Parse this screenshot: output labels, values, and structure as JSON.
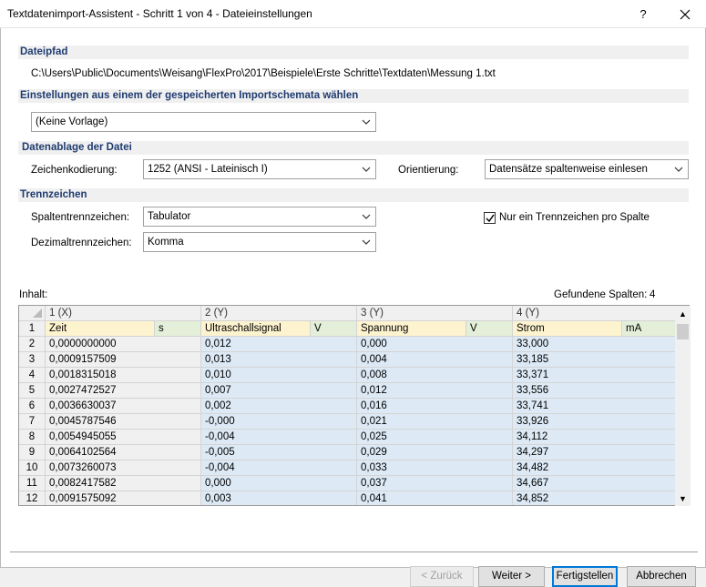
{
  "window": {
    "title": "Textdatenimport-Assistent - Schritt 1 von 4 - Dateieinstellungen",
    "help": "?",
    "close": "✕"
  },
  "sections": {
    "path": {
      "header": "Dateipfad",
      "value": "C:\\Users\\Public\\Documents\\Weisang\\FlexPro\\2017\\Beispiele\\Erste Schritte\\Textdaten\\Messung 1.txt"
    },
    "schema": {
      "header": "Einstellungen aus einem der gespeicherten Importschemata wählen",
      "combo": "(Keine Vorlage)"
    },
    "storage": {
      "header": "Datenablage der Datei",
      "encoding_label": "Zeichenkodierung:",
      "encoding_value": "1252  (ANSI - Lateinisch I)",
      "orientation_label": "Orientierung:",
      "orientation_value": "Datensätze spaltenweise einlesen"
    },
    "separators": {
      "header": "Trennzeichen",
      "column_label": "Spaltentrennzeichen:",
      "column_value": "Tabulator",
      "decimal_label": "Dezimaltrennzeichen:",
      "decimal_value": "Komma",
      "single_sep_label": "Nur ein Trennzeichen pro Spalte",
      "single_sep_checked": true
    }
  },
  "content": {
    "label": "Inhalt:",
    "found_label": "Gefundene Spalten:",
    "found_count": "4"
  },
  "grid": {
    "columns": [
      "1 (X)",
      "2 (Y)",
      "3 (Y)",
      "4 (Y)"
    ],
    "label_row": {
      "num": "1",
      "cells": [
        "Zeit",
        "s",
        "Ultraschallsignal",
        "V",
        "Spannung",
        "V",
        "Strom",
        "mA"
      ]
    },
    "rows": [
      {
        "n": "2",
        "v": [
          "0,0000000000",
          "0,012",
          "0,000",
          "33,000"
        ]
      },
      {
        "n": "3",
        "v": [
          "0,0009157509",
          "0,013",
          "0,004",
          "33,185"
        ]
      },
      {
        "n": "4",
        "v": [
          "0,0018315018",
          "0,010",
          "0,008",
          "33,371"
        ]
      },
      {
        "n": "5",
        "v": [
          "0,0027472527",
          "0,007",
          "0,012",
          "33,556"
        ]
      },
      {
        "n": "6",
        "v": [
          "0,0036630037",
          "0,002",
          "0,016",
          "33,741"
        ]
      },
      {
        "n": "7",
        "v": [
          "0,0045787546",
          "-0,000",
          "0,021",
          "33,926"
        ]
      },
      {
        "n": "8",
        "v": [
          "0,0054945055",
          "-0,004",
          "0,025",
          "34,112"
        ]
      },
      {
        "n": "9",
        "v": [
          "0,0064102564",
          "-0,005",
          "0,029",
          "34,297"
        ]
      },
      {
        "n": "10",
        "v": [
          "0,0073260073",
          "-0,004",
          "0,033",
          "34,482"
        ]
      },
      {
        "n": "11",
        "v": [
          "0,0082417582",
          "0,000",
          "0,037",
          "34,667"
        ]
      },
      {
        "n": "12",
        "v": [
          "0,0091575092",
          "0,003",
          "0,041",
          "34,852"
        ]
      }
    ]
  },
  "buttons": {
    "back": "< Zurück",
    "next": "Weiter >",
    "finish": "Fertigstellen",
    "cancel": "Abbrechen"
  }
}
